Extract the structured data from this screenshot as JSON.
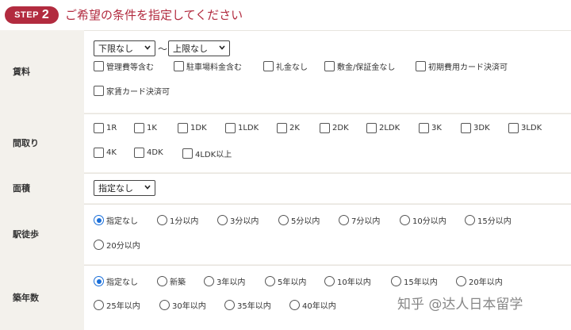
{
  "step": {
    "badge_word": "STEP",
    "badge_number": "2",
    "title": "ご希望の条件を指定してください"
  },
  "rent": {
    "label": "賃料",
    "lower_select": "下限なし",
    "upper_select": "上限なし",
    "tilde": "～",
    "options": [
      "管理費等含む",
      "駐車場料金含む",
      "礼金なし",
      "敷金/保証金なし",
      "初期費用カード決済可",
      "家賃カード決済可"
    ]
  },
  "layout": {
    "label": "間取り",
    "options": [
      "1R",
      "1K",
      "1DK",
      "1LDK",
      "2K",
      "2DK",
      "2LDK",
      "3K",
      "3DK",
      "3LDK",
      "4K",
      "4DK",
      "4LDK以上"
    ]
  },
  "area": {
    "label": "面積",
    "select": "指定なし"
  },
  "walk": {
    "label": "駅徒歩",
    "options": [
      "指定なし",
      "1分以内",
      "3分以内",
      "5分以内",
      "7分以内",
      "10分以内",
      "15分以内",
      "20分以内"
    ],
    "selected": "指定なし"
  },
  "age": {
    "label": "築年数",
    "options": [
      "指定なし",
      "新築",
      "3年以内",
      "5年以内",
      "10年以内",
      "15年以内",
      "20年以内",
      "25年以内",
      "30年以内",
      "35年以内",
      "40年以内"
    ],
    "selected": "指定なし"
  },
  "watermark": "知乎 @达人日本留学",
  "colors": {
    "accent": "#b22b3f",
    "radio_checked": "#1a6fd9",
    "label_bg": "#f3f1ec"
  },
  "icons": {
    "select_arrow": "chevron-down-icon"
  }
}
